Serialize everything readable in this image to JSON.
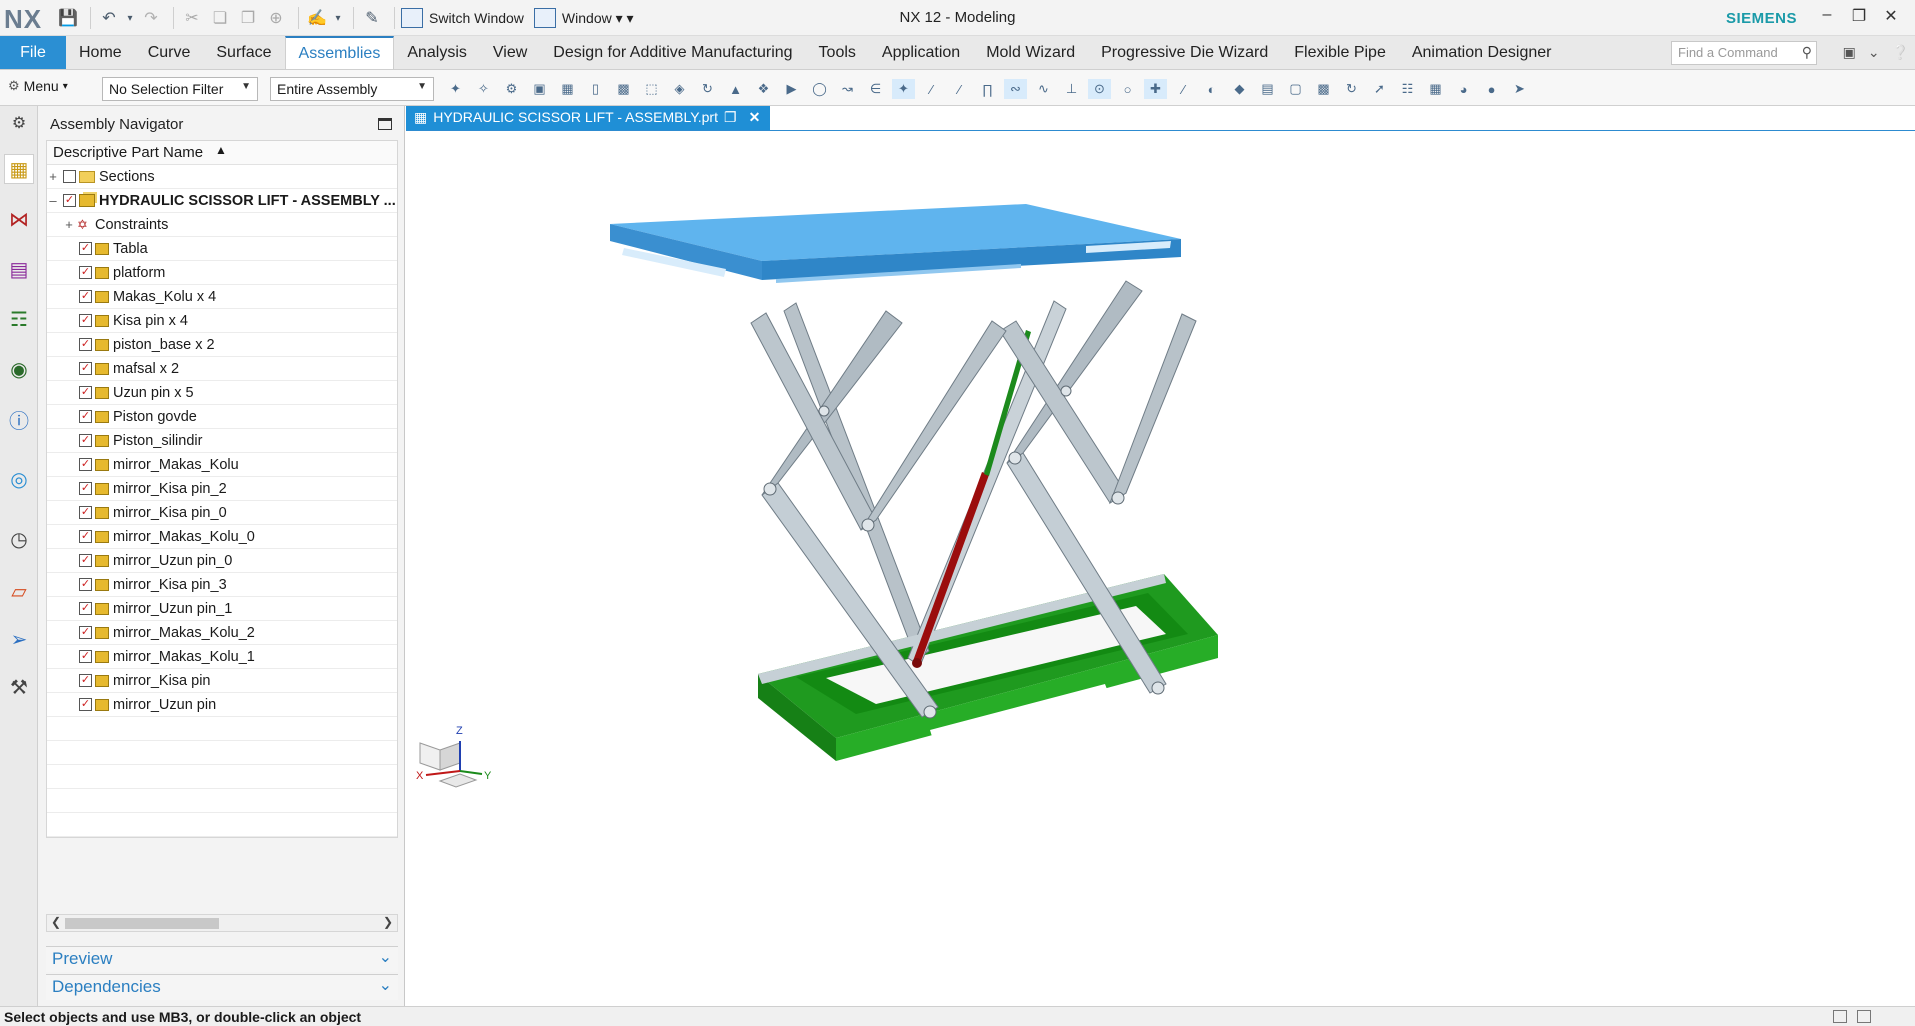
{
  "window": {
    "title": "NX 12 - Modeling",
    "logo": "NX",
    "brand": "SIEMENS"
  },
  "quick_access": {
    "switch_window": "Switch Window",
    "window_menu": "Window"
  },
  "ribbon": {
    "file": "File",
    "tabs": [
      "Home",
      "Curve",
      "Surface",
      "Assemblies",
      "Analysis",
      "View",
      "Design for Additive Manufacturing",
      "Tools",
      "Application",
      "Mold Wizard",
      "Progressive Die Wizard",
      "Flexible Pipe",
      "Animation Designer"
    ],
    "active_tab": "Assemblies",
    "find_placeholder": "Find a Command"
  },
  "selection_bar": {
    "menu": "Menu",
    "filter": "No Selection Filter",
    "scope": "Entire Assembly"
  },
  "navigator": {
    "title": "Assembly Navigator",
    "column": "Descriptive Part Name",
    "sections": "Sections",
    "assembly": "HYDRAULIC SCISSOR LIFT - ASSEMBLY ...",
    "constraints": "Constraints",
    "parts": [
      "Tabla",
      "platform",
      "Makas_Kolu x 4",
      "Kisa pin x 4",
      "piston_base x 2",
      "mafsal x 2",
      "Uzun pin x 5",
      "Piston govde",
      "Piston_silindir",
      "mirror_Makas_Kolu",
      "mirror_Kisa pin_2",
      "mirror_Kisa pin_0",
      "mirror_Makas_Kolu_0",
      "mirror_Uzun pin_0",
      "mirror_Kisa pin_3",
      "mirror_Uzun pin_1",
      "mirror_Makas_Kolu_2",
      "mirror_Makas_Kolu_1",
      "mirror_Kisa pin",
      "mirror_Uzun pin"
    ],
    "preview": "Preview",
    "dependencies": "Dependencies"
  },
  "graphics": {
    "tab": "HYDRAULIC SCISSOR LIFT - ASSEMBLY.prt",
    "triad": {
      "x": "X",
      "y": "Y",
      "z": "Z"
    },
    "colors": {
      "top": "#4aa3e6",
      "base": "#1f9a1f",
      "arms": "#b9c3ca",
      "rod": "#1c8a1c",
      "cylinder": "#9b0d0d"
    }
  },
  "status": {
    "message": "Select objects and use MB3, or double-click an object"
  }
}
